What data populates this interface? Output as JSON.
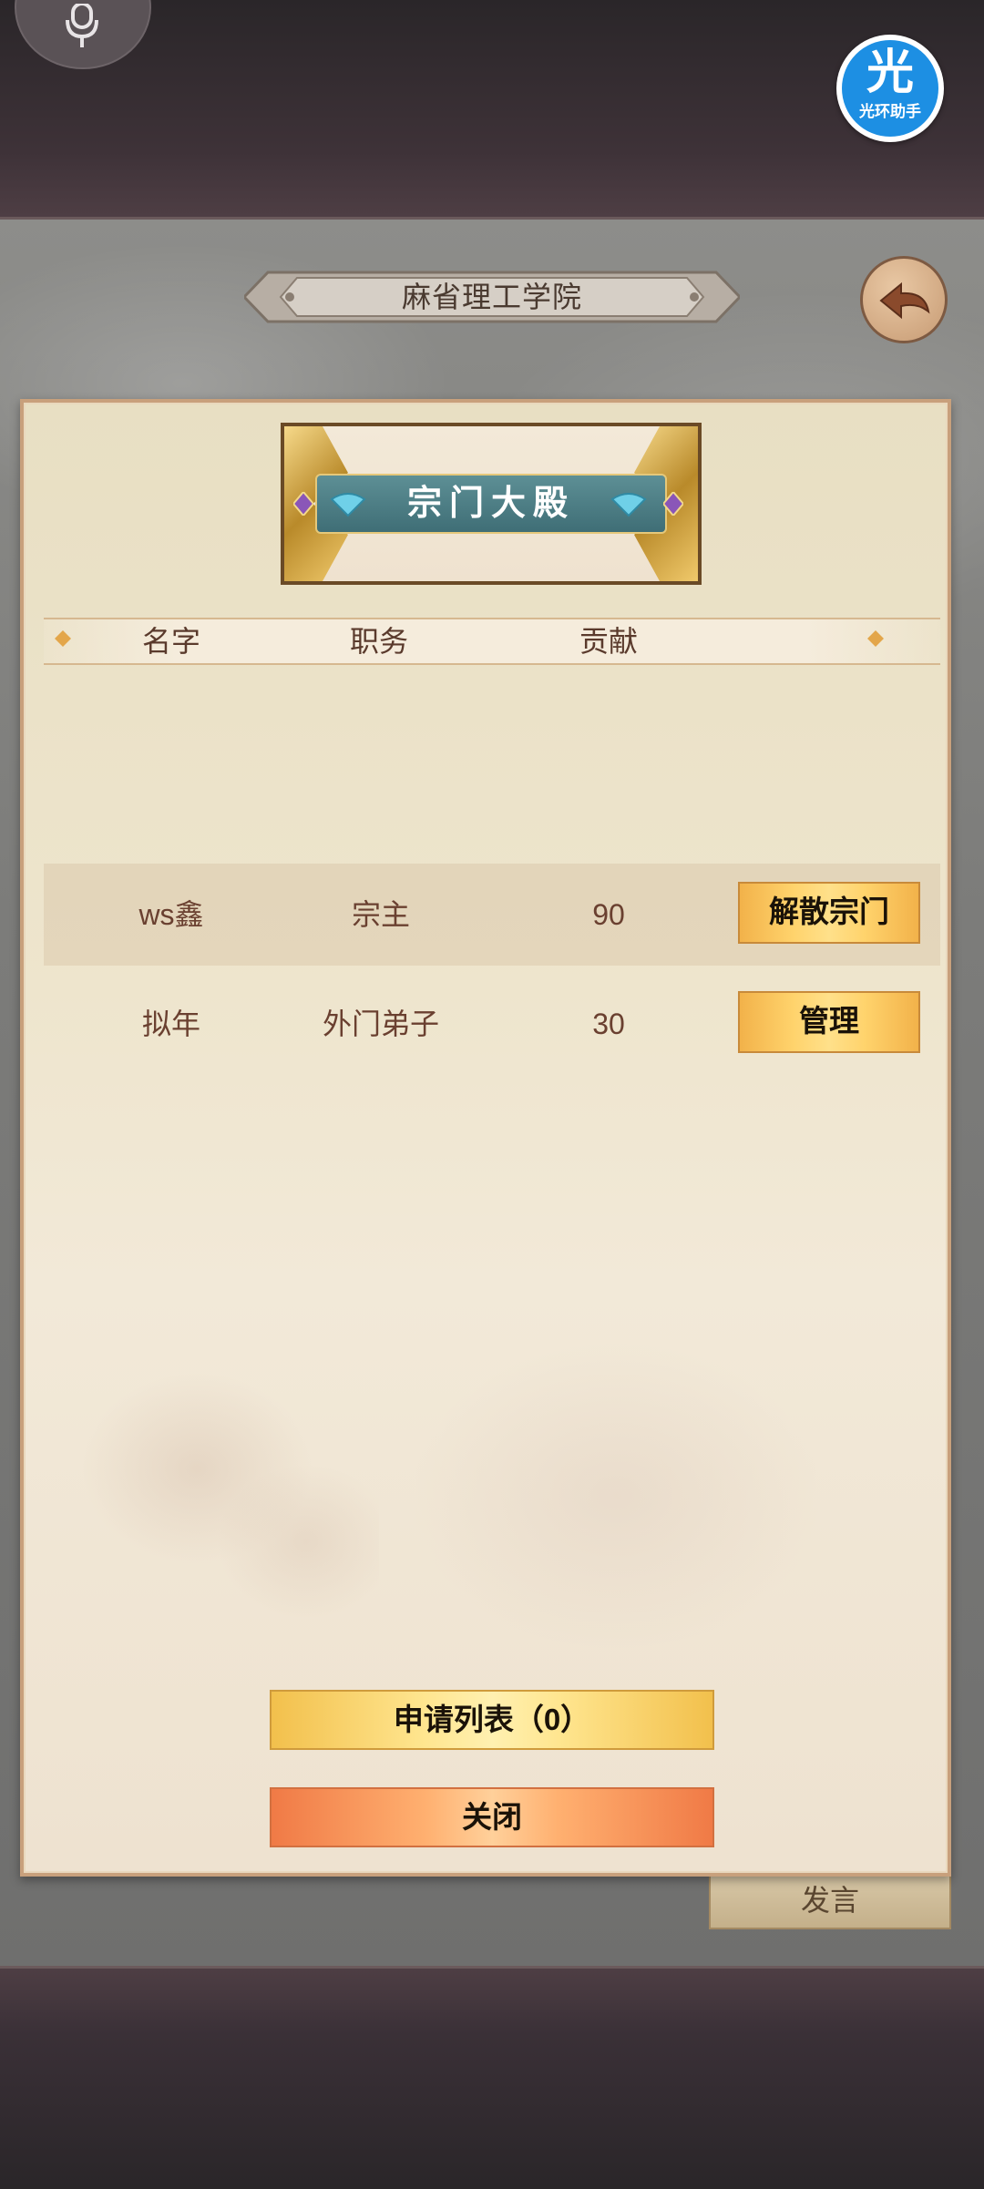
{
  "top_bar": {
    "helper_badge_glyph": "光",
    "helper_badge_caption": "光环助手"
  },
  "sect": {
    "name": "麻省理工学院"
  },
  "panel": {
    "title": "宗门大殿",
    "columns": [
      "名字",
      "职务",
      "贡献"
    ],
    "members": [
      {
        "name": "ws鑫",
        "role": "宗主",
        "contribution": "90",
        "action": "解散宗门"
      },
      {
        "name": "拟年",
        "role": "外门弟子",
        "contribution": "30",
        "action": "管理"
      }
    ],
    "apply_list_label": "申请列表（0）",
    "close_label": "关闭"
  },
  "chat": {
    "speak_label": "发言"
  },
  "colors": {
    "accent_gold": "#ffd36c",
    "close_orange": "#ffb070",
    "banner_teal": "#4f7e86",
    "text_brown": "#6a4030"
  },
  "icons": [
    "mic-icon",
    "back-arrow-icon",
    "fan-icon",
    "gem-icon",
    "diamond-icon"
  ]
}
